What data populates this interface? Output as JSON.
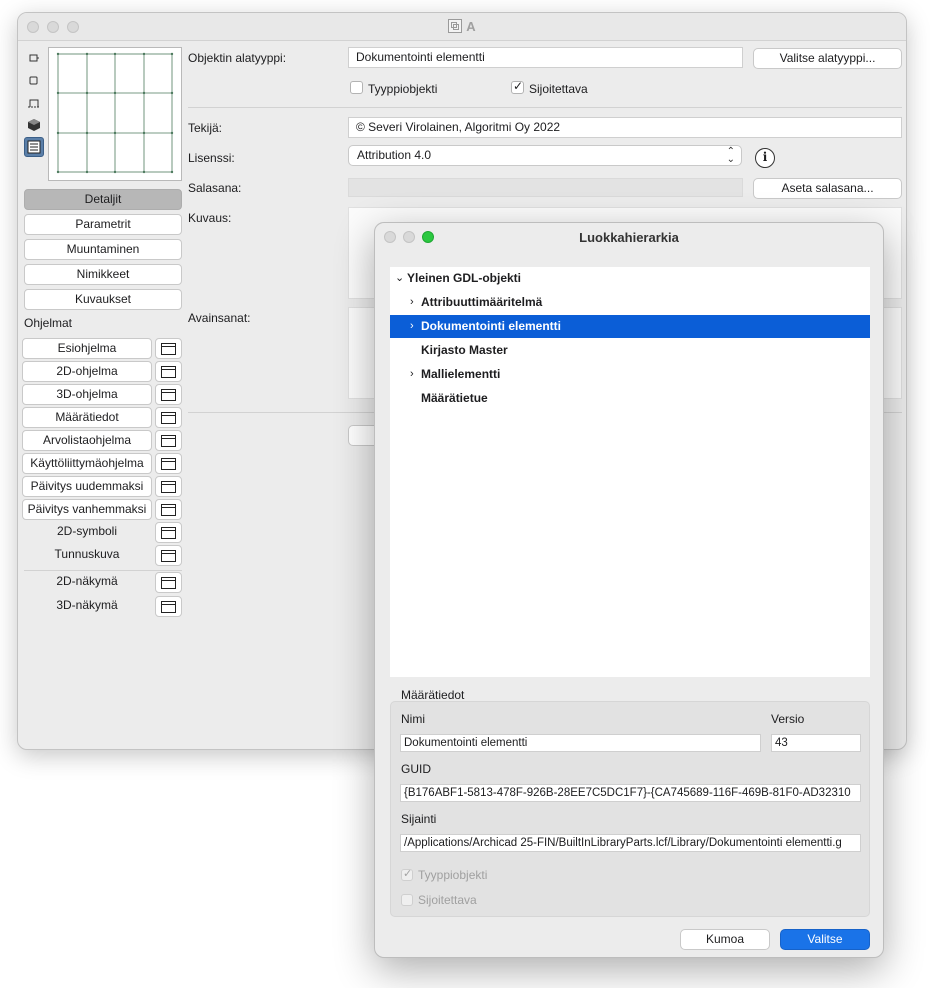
{
  "main_window": {
    "title": "A",
    "nav": [
      "Detaljit",
      "Parametrit",
      "Muuntaminen",
      "Nimikkeet",
      "Kuvaukset"
    ],
    "programs_label": "Ohjelmat",
    "programs": [
      {
        "label": "Esiohjelma",
        "button": true
      },
      {
        "label": "2D-ohjelma",
        "button": true
      },
      {
        "label": "3D-ohjelma",
        "button": true
      },
      {
        "label": "Määrätiedot",
        "button": true
      },
      {
        "label": "Arvolistaohjelma",
        "button": true
      },
      {
        "label": "Käyttöliittymäohjelma",
        "button": true
      },
      {
        "label": "Päivitys uudemmaksi",
        "button": true
      },
      {
        "label": "Päivitys vanhemmaksi",
        "button": true
      },
      {
        "label": "2D-symboli",
        "button": false
      },
      {
        "label": "Tunnuskuva",
        "button": false
      },
      {
        "label": "2D-näkymä",
        "button": false
      },
      {
        "label": "3D-näkymä",
        "button": false
      }
    ],
    "subtype_label": "Objektin alatyyppi:",
    "subtype_value": "Dokumentointi elementti",
    "choose_subtype_button": "Valitse alatyyppi...",
    "type_object_label": "Tyyppiobjekti",
    "type_object_checked": false,
    "placeable_label": "Sijoitettava",
    "placeable_checked": true,
    "author_label": "Tekijä:",
    "author_value": "© Severi Virolainen, Algoritmi Oy 2022",
    "license_label": "Lisenssi:",
    "license_value": "Attribution 4.0",
    "password_label": "Salasana:",
    "set_password_button": "Aseta salasana...",
    "description_label": "Kuvaus:",
    "keywords_label": "Avainsanat:"
  },
  "dialog": {
    "title": "Luokkahierarkia",
    "tree": [
      {
        "label": "Yleinen GDL-objekti",
        "level": 0,
        "expanded": true,
        "has_children": true,
        "selected": false
      },
      {
        "label": "Attribuuttimääritelmä",
        "level": 1,
        "expanded": false,
        "has_children": true,
        "selected": false
      },
      {
        "label": "Dokumentointi elementti",
        "level": 1,
        "expanded": false,
        "has_children": true,
        "selected": true
      },
      {
        "label": "Kirjasto Master",
        "level": 1,
        "expanded": false,
        "has_children": false,
        "selected": false
      },
      {
        "label": "Mallielementti",
        "level": 1,
        "expanded": false,
        "has_children": true,
        "selected": false
      },
      {
        "label": "Määrätietue",
        "level": 1,
        "expanded": false,
        "has_children": false,
        "selected": false
      }
    ],
    "details_title": "Määrätiedot",
    "name_label": "Nimi",
    "name_value": "Dokumentointi elementti",
    "version_label": "Versio",
    "version_value": "43",
    "guid_label": "GUID",
    "guid_value": "{B176ABF1-5813-478F-926B-28EE7C5DC1F7}-{CA745689-116F-469B-81F0-AD32310",
    "location_label": "Sijainti",
    "location_value": "/Applications/Archicad 25-FIN/BuiltInLibraryParts.lcf/Library/Dokumentointi elementti.g",
    "type_object_label": "Tyyppiobjekti",
    "type_object_checked": true,
    "placeable_label": "Sijoitettava",
    "placeable_checked": false,
    "cancel_button": "Kumoa",
    "ok_button": "Valitse"
  },
  "colors": {
    "accent": "#1a73e8",
    "selection": "#0b5ed7",
    "window_bg": "#ececec"
  },
  "icons": [
    "traffic-light-close",
    "traffic-light-minimize",
    "traffic-light-zoom",
    "object-icon",
    "script-edit-icon",
    "disclosure-chevron-icon",
    "info-icon",
    "popup-chevron-icon",
    "checkmark-icon"
  ]
}
